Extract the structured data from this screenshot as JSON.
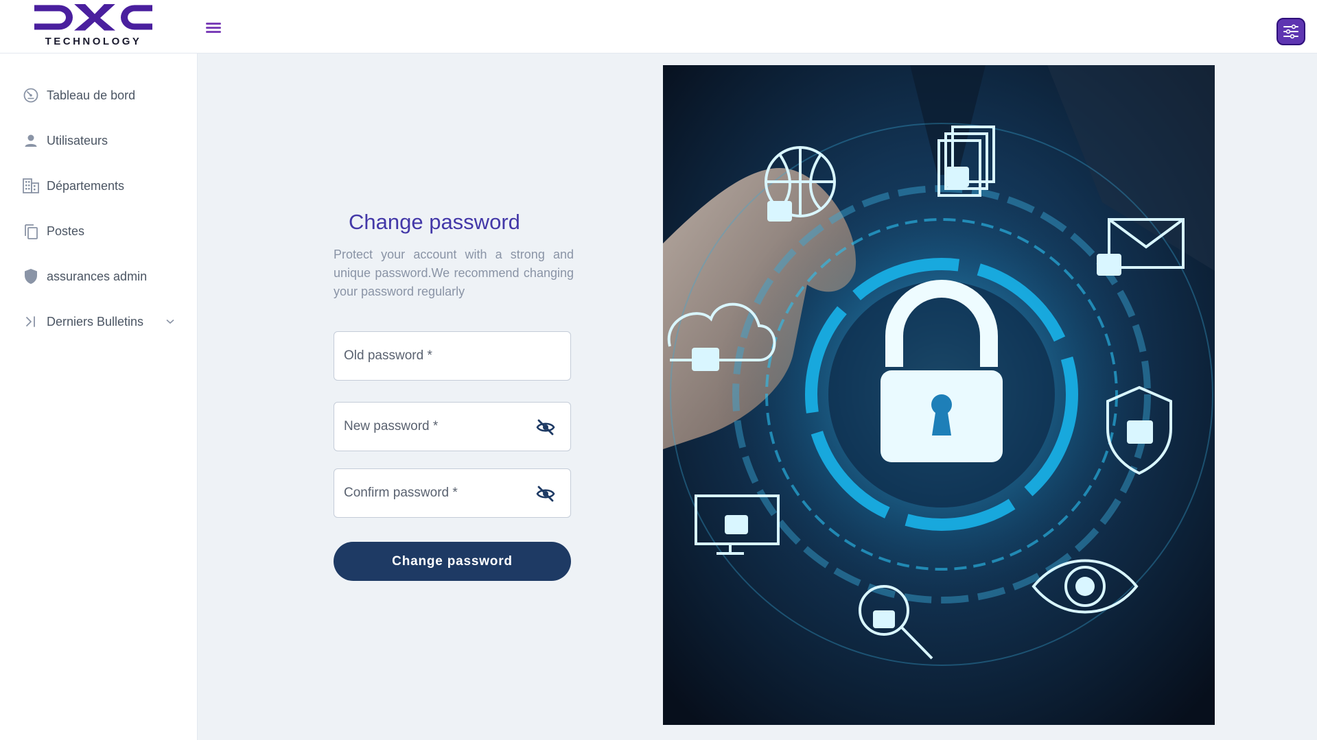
{
  "brand": {
    "name": "DXC",
    "subtitle": "TECHNOLOGY",
    "color": "#4a1f9e"
  },
  "sidebar": {
    "items": [
      {
        "label": "Tableau de bord",
        "icon": "dashboard-icon"
      },
      {
        "label": "Utilisateurs",
        "icon": "user-icon"
      },
      {
        "label": "Départements",
        "icon": "building-icon"
      },
      {
        "label": "Postes",
        "icon": "copy-icon"
      },
      {
        "label": "assurances admin",
        "icon": "shield-icon"
      },
      {
        "label": "Derniers Bulletins",
        "icon": "collapse-arrow-icon",
        "expandable": true
      }
    ]
  },
  "form": {
    "title": "Change password",
    "subtitle": "Protect your account with a strong and unique password.We recommend changing your password regularly",
    "fields": {
      "old": {
        "label": "Old password *",
        "value": ""
      },
      "new": {
        "label": "New password *",
        "value": "",
        "toggle_icon": "eye-off-icon"
      },
      "confirm": {
        "label": "Confirm password *",
        "value": "",
        "toggle_icon": "eye-off-icon"
      }
    },
    "submit_label": "Change password"
  },
  "colors": {
    "accent": "#4338a8",
    "button": "#1e3a64",
    "background": "#eef2f6",
    "settings_button": "#5e35b1"
  },
  "illustration": {
    "subject": "cybersecurity-padlock-illustration"
  }
}
